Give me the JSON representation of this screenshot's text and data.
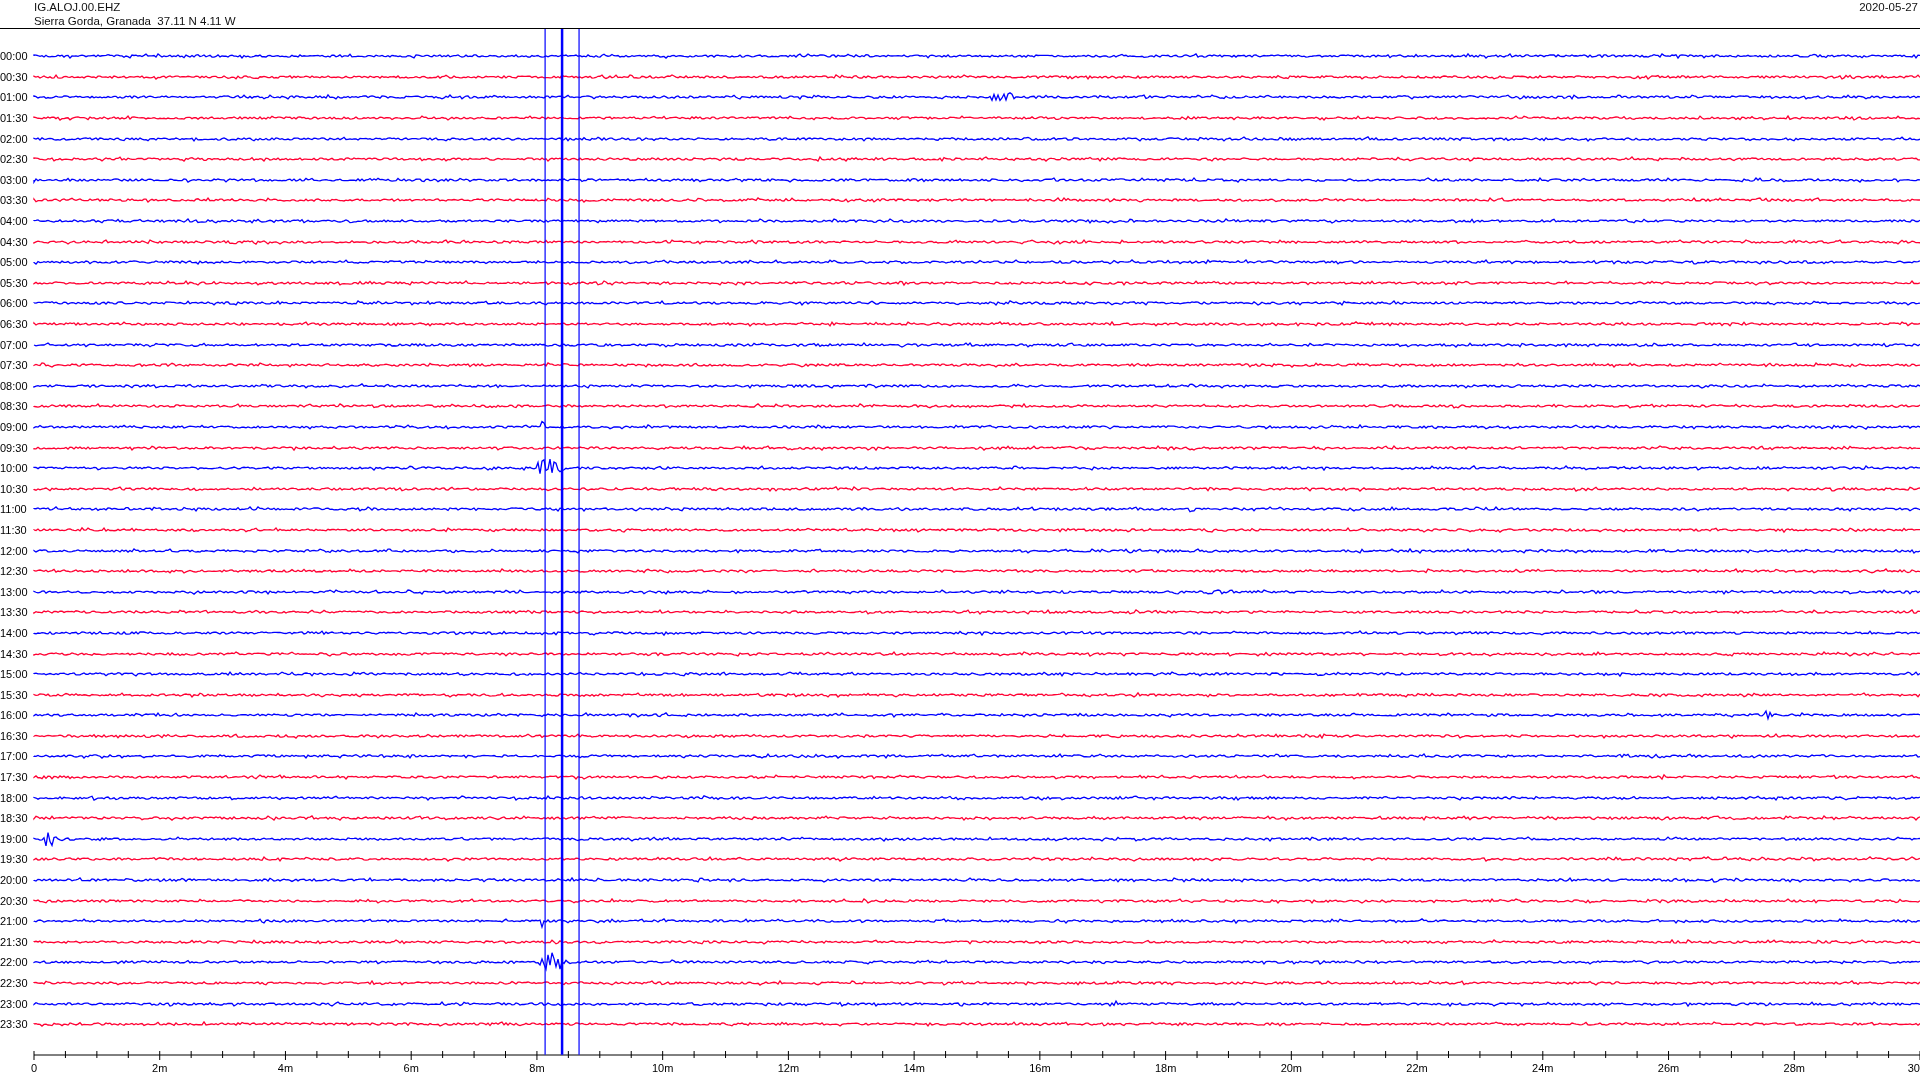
{
  "header": {
    "station": "IG.ALOJ.00.EHZ",
    "location": "Sierra Gorda, Granada  37.11 N 4.11 W",
    "date": "2020-05-27"
  },
  "traces": [
    {
      "time": "00:00",
      "color": "#0000ff"
    },
    {
      "time": "00:30",
      "color": "#ff0033"
    },
    {
      "time": "01:00",
      "color": "#0000ff"
    },
    {
      "time": "01:30",
      "color": "#ff0033"
    },
    {
      "time": "02:00",
      "color": "#0000ff"
    },
    {
      "time": "02:30",
      "color": "#ff0033"
    },
    {
      "time": "03:00",
      "color": "#0000ff"
    },
    {
      "time": "03:30",
      "color": "#ff0033"
    },
    {
      "time": "04:00",
      "color": "#0000ff"
    },
    {
      "time": "04:30",
      "color": "#ff0033"
    },
    {
      "time": "05:00",
      "color": "#0000ff"
    },
    {
      "time": "05:30",
      "color": "#ff0033"
    },
    {
      "time": "06:00",
      "color": "#0000ff"
    },
    {
      "time": "06:30",
      "color": "#ff0033"
    },
    {
      "time": "07:00",
      "color": "#0000ff"
    },
    {
      "time": "07:30",
      "color": "#ff0033"
    },
    {
      "time": "08:00",
      "color": "#0000ff"
    },
    {
      "time": "08:30",
      "color": "#ff0033"
    },
    {
      "time": "09:00",
      "color": "#0000ff"
    },
    {
      "time": "09:30",
      "color": "#ff0033"
    },
    {
      "time": "10:00",
      "color": "#0000ff"
    },
    {
      "time": "10:30",
      "color": "#ff0033"
    },
    {
      "time": "11:00",
      "color": "#0000ff"
    },
    {
      "time": "11:30",
      "color": "#ff0033"
    },
    {
      "time": "12:00",
      "color": "#0000ff"
    },
    {
      "time": "12:30",
      "color": "#ff0033"
    },
    {
      "time": "13:00",
      "color": "#0000ff"
    },
    {
      "time": "13:30",
      "color": "#ff0033"
    },
    {
      "time": "14:00",
      "color": "#0000ff"
    },
    {
      "time": "14:30",
      "color": "#ff0033"
    },
    {
      "time": "15:00",
      "color": "#0000ff"
    },
    {
      "time": "15:30",
      "color": "#ff0033"
    },
    {
      "time": "16:00",
      "color": "#0000ff"
    },
    {
      "time": "16:30",
      "color": "#ff0033"
    },
    {
      "time": "17:00",
      "color": "#0000ff"
    },
    {
      "time": "17:30",
      "color": "#ff0033"
    },
    {
      "time": "18:00",
      "color": "#0000ff"
    },
    {
      "time": "18:30",
      "color": "#ff0033"
    },
    {
      "time": "19:00",
      "color": "#0000ff"
    },
    {
      "time": "19:30",
      "color": "#ff0033"
    },
    {
      "time": "20:00",
      "color": "#0000ff"
    },
    {
      "time": "20:30",
      "color": "#ff0033"
    },
    {
      "time": "21:00",
      "color": "#0000ff"
    },
    {
      "time": "21:30",
      "color": "#ff0033"
    },
    {
      "time": "22:00",
      "color": "#0000ff"
    },
    {
      "time": "22:30",
      "color": "#ff0033"
    },
    {
      "time": "23:00",
      "color": "#0000ff"
    },
    {
      "time": "23:30",
      "color": "#ff0033"
    }
  ],
  "x_axis": {
    "ticks": [
      "0",
      "2m",
      "4m",
      "6m",
      "8m",
      "10m",
      "12m",
      "14m",
      "16m",
      "18m",
      "20m",
      "22m",
      "24m",
      "26m",
      "28m",
      "30"
    ]
  }
}
